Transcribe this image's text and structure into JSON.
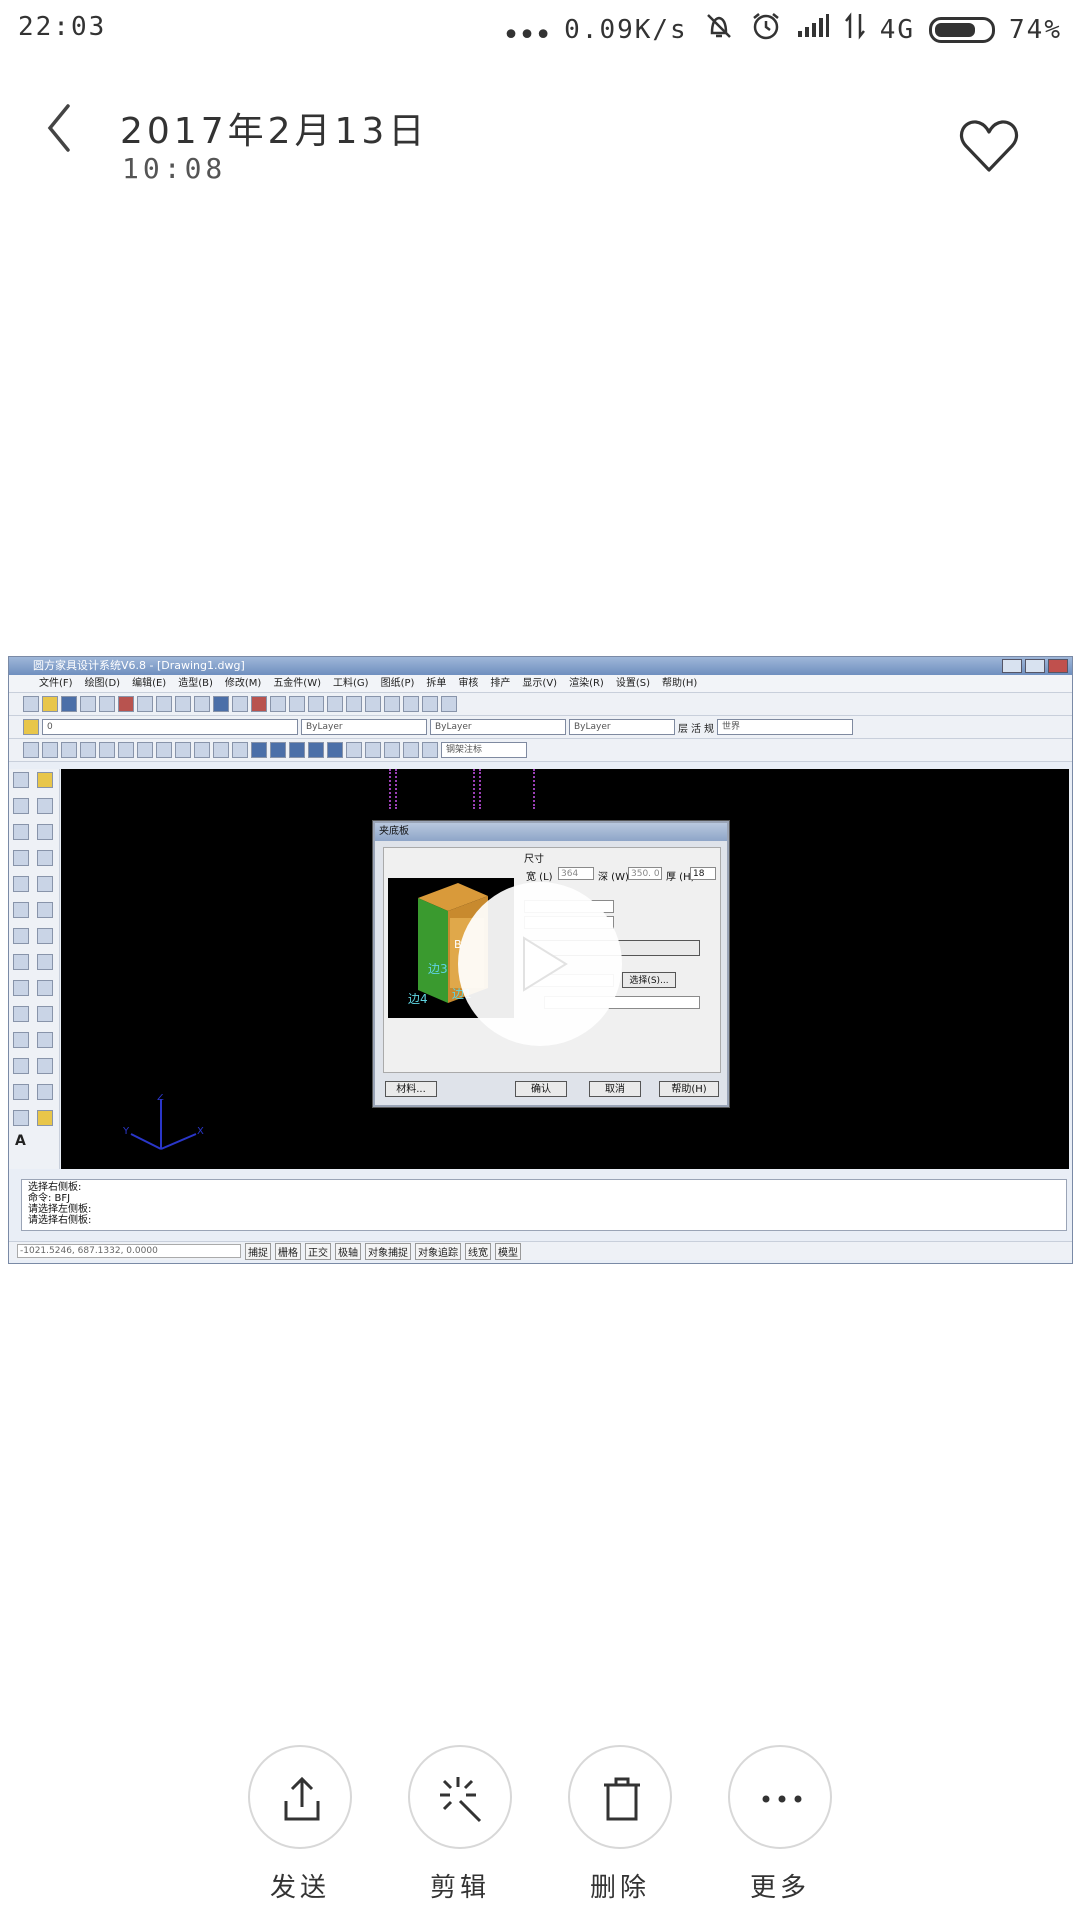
{
  "status_bar": {
    "time": "22:03",
    "network_speed": "0.09K/s",
    "network_type": "4G",
    "battery": "74%",
    "battery_level": 0.74,
    "icons": [
      "more-dots-icon",
      "silent-icon",
      "alarm-icon",
      "signal-icon",
      "data-arrows-icon",
      "battery-icon"
    ]
  },
  "header": {
    "date": "2017年2月13日",
    "time": "10:08",
    "back_icon": "chevron-left-icon",
    "favorite_icon": "heart-icon"
  },
  "video": {
    "cad": {
      "window_title": "圆方家具设计系统V6.8 - [Drawing1.dwg]",
      "menu": [
        "文件(F)",
        "绘图(D)",
        "编辑(E)",
        "造型(B)",
        "修改(M)",
        "五金件(W)",
        "工料(G)",
        "图纸(P)",
        "拆单",
        "审核",
        "排产",
        "显示(V)",
        "渲染(R)",
        "设置(S)",
        "帮助(H)"
      ],
      "layer_combo": "0",
      "color_combo": "ByLayer",
      "linetype_combo": "ByLayer",
      "lineweight_combo": "ByLayer",
      "ucs_combo": "世界",
      "dim_combo": "钢架注标",
      "toolbar_text": [
        "层",
        "活",
        "规"
      ],
      "dialog": {
        "title": "夹底板",
        "size_label": "尺寸",
        "width_label": "宽 (L)",
        "width_value": "364",
        "depth_label": "深 (W)",
        "depth_value": "350. 0",
        "thick_label": "厚 (H)",
        "thick_value": "18",
        "preview_labels": [
          "B",
          "边3",
          "边4",
          "边1"
        ],
        "select_button": "选择(S)...",
        "material_button": "材料...",
        "ok_button": "确认",
        "cancel_button": "取消",
        "help_button": "帮助(H)"
      },
      "command_lines": [
        "选择右侧板:",
        "命令: BFJ",
        "请选择左侧板:",
        "请选择右侧板:"
      ],
      "coords": "-1021.5246, 687.1332, 0.0000",
      "status_toggles": [
        "捕捉",
        "栅格",
        "正交",
        "极轴",
        "对象捕捉",
        "对象追踪",
        "线宽",
        "模型"
      ]
    },
    "play_icon": "play-icon"
  },
  "actions": [
    {
      "label": "发送",
      "icon": "share-icon"
    },
    {
      "label": "剪辑",
      "icon": "magic-edit-icon"
    },
    {
      "label": "删除",
      "icon": "trash-icon"
    },
    {
      "label": "更多",
      "icon": "more-icon"
    }
  ]
}
